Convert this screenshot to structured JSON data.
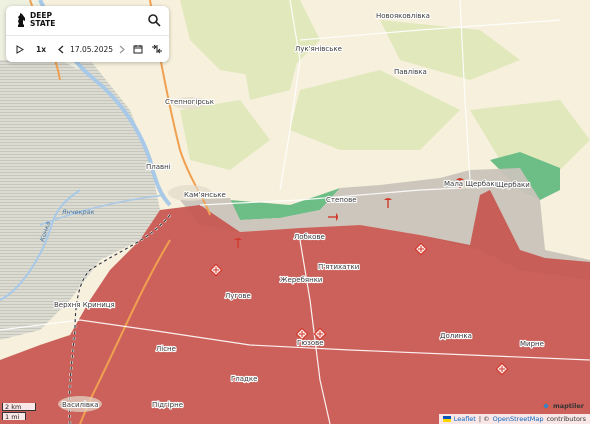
{
  "brand": {
    "name": "DEEP STATE"
  },
  "controls": {
    "speed": "1x",
    "date": "17.05.2025"
  },
  "places": [
    {
      "name": "Новояковлівка"
    },
    {
      "name": "Лук'янівське"
    },
    {
      "name": "Павлівка"
    },
    {
      "name": "Степногірськ"
    },
    {
      "name": "Плавні"
    },
    {
      "name": "Кам'янське"
    },
    {
      "name": "Степове"
    },
    {
      "name": "Мала Щербаки"
    },
    {
      "name": "Щербаки"
    },
    {
      "name": "Лобкове"
    },
    {
      "name": "П'ятихатки"
    },
    {
      "name": "Жеребянки"
    },
    {
      "name": "Лугове"
    },
    {
      "name": "Верхня Криниця"
    },
    {
      "name": "Лісне"
    },
    {
      "name": "Гюзове"
    },
    {
      "name": "Долинка"
    },
    {
      "name": "Мирне"
    },
    {
      "name": "Гладке"
    },
    {
      "name": "Підгірне"
    },
    {
      "name": "Василівка"
    }
  ],
  "water_labels": [
    {
      "name": "Янчекрак"
    },
    {
      "name": "Конка"
    }
  ],
  "scale": {
    "metric": "2 km",
    "imperial": "1 mi"
  },
  "attribution": {
    "leaflet": "Leaflet",
    "separator": "| ©",
    "osm": "OpenStreetMap",
    "contributors": "contributors",
    "maptiler": "maptiler"
  },
  "colors": {
    "occupied": "#c8554f",
    "grey_zone": "#c9c3bb",
    "liberated": "#6dbd86",
    "land": "#f6f0dc",
    "river": "#a8c9e8",
    "road_major": "#f0a050",
    "marker": "#d23a2e"
  }
}
